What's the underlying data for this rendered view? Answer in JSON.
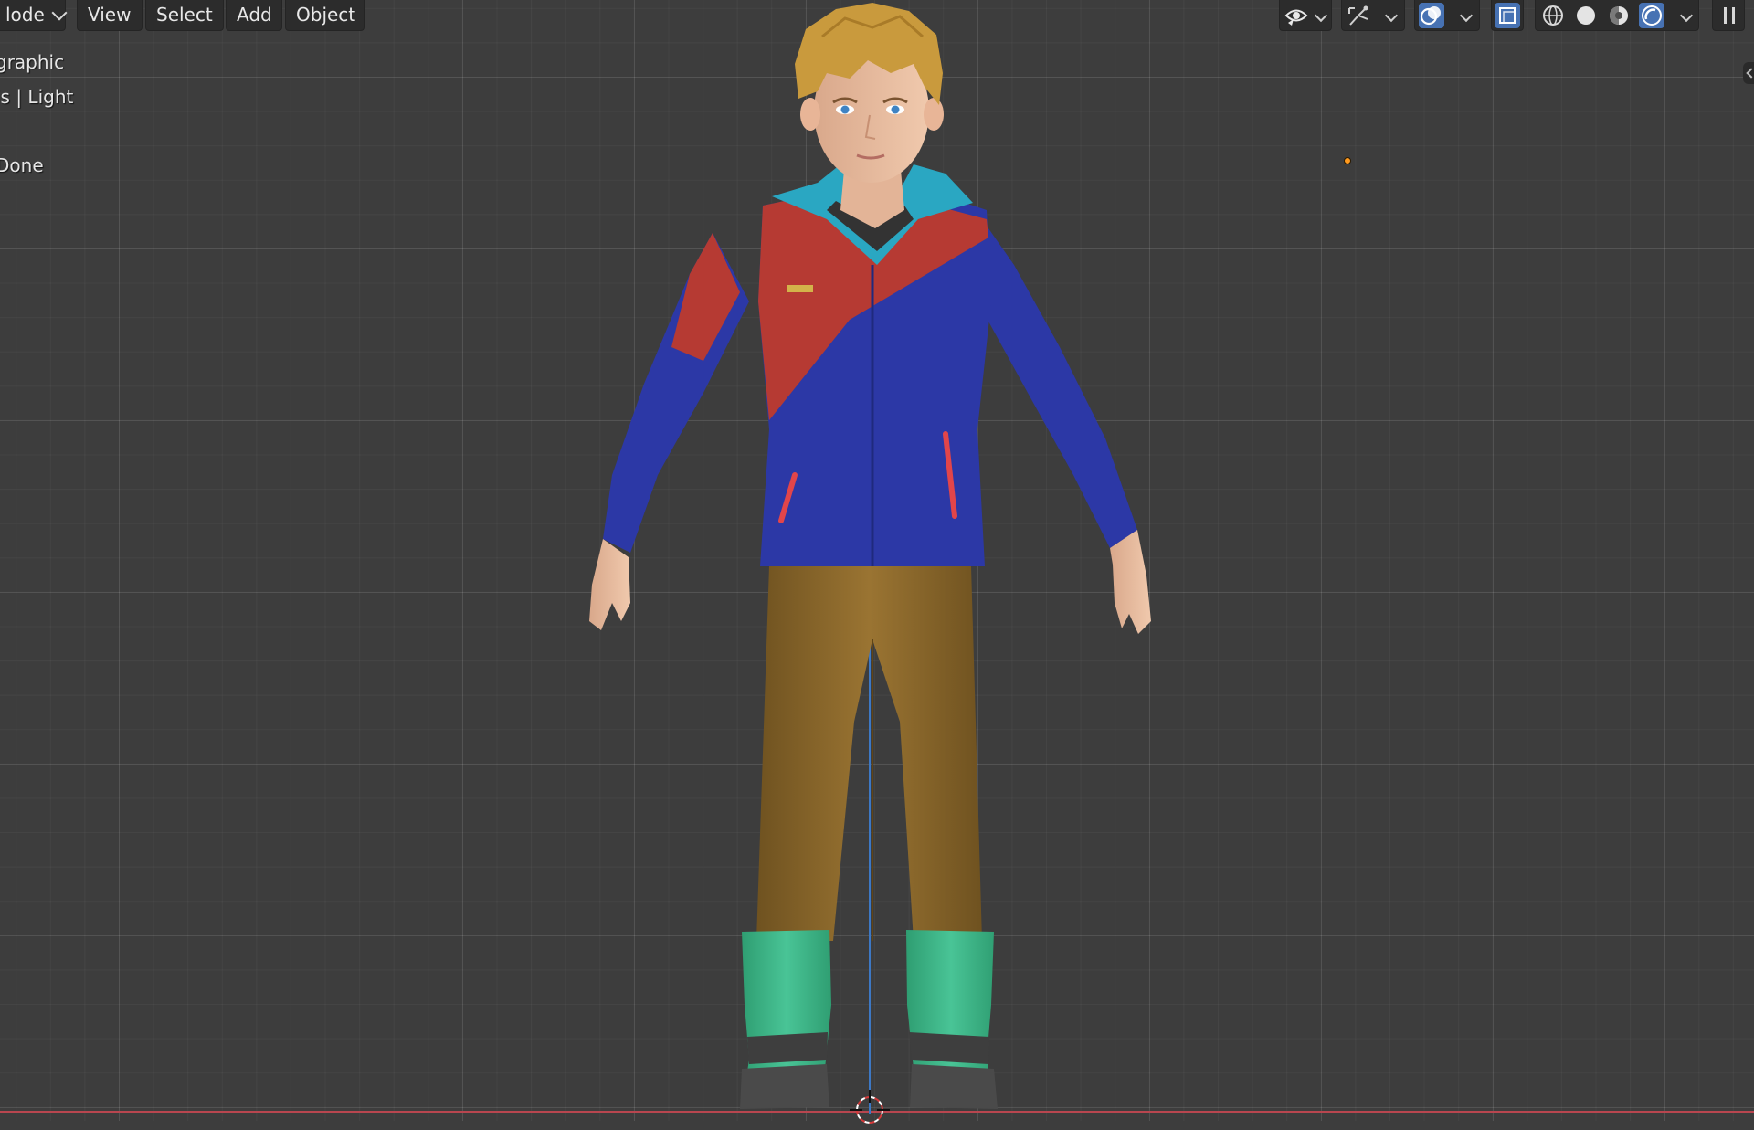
{
  "header": {
    "mode_label": "lode",
    "menus": [
      "View",
      "Select",
      "Add",
      "Object"
    ]
  },
  "overlay": {
    "view_name": "graphic",
    "collection_info": "is | Light",
    "status": "Done"
  },
  "toolbar": {
    "icons": [
      "visibility-eye-icon",
      "gizmo-icon",
      "overlays-icon",
      "xray-icon",
      "wireframe-shading-icon",
      "solid-shading-icon",
      "material-preview-shading-icon",
      "rendered-shading-icon",
      "pause-icon"
    ],
    "active_icons": [
      "overlays-icon",
      "rendered-shading-icon"
    ]
  },
  "colors": {
    "viewport_bg": "#3d3d3d",
    "header_bg": "#2c2c2c",
    "accent_blue": "#4772b3",
    "x_axis": "#b8464f",
    "z_axis": "#3d78c4",
    "light_dot": "#ff9a1f",
    "jacket_red": "#b63a33",
    "jacket_blue": "#2c38a6",
    "collar_teal": "#2aa7c2",
    "pants_brown": "#8e6a2c",
    "boots_green": "#3dbb8a",
    "hair_blonde": "#c99a3d"
  },
  "scene": {
    "object": "character-model-boy-in-a-pose"
  }
}
